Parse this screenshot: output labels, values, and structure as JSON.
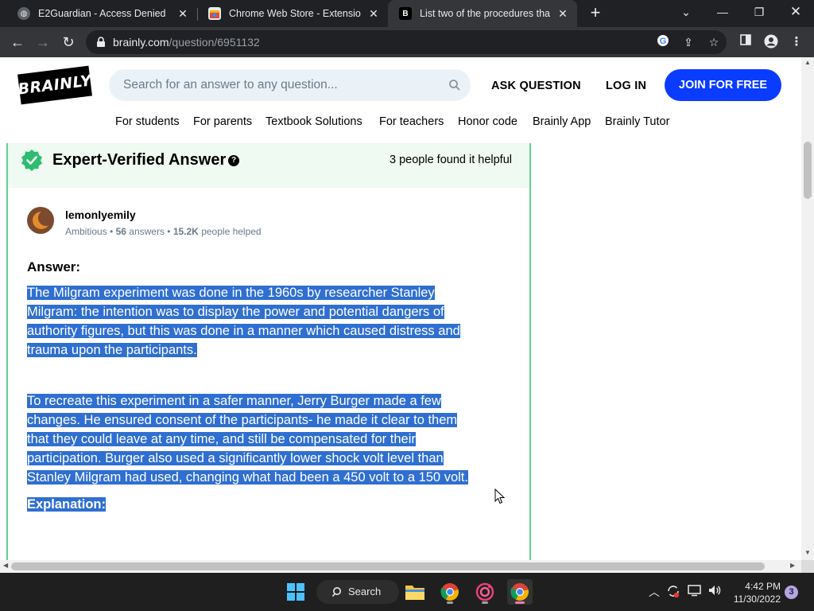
{
  "browser": {
    "tabs": [
      {
        "title": "E2Guardian - Access Denied",
        "active": false
      },
      {
        "title": "Chrome Web Store - Extensions",
        "active": false
      },
      {
        "title": "List two of the procedures that U",
        "active": true
      }
    ],
    "new_tab_symbol": "+",
    "url_domain": "brainly.com",
    "url_path": "/question/6951132",
    "icons": [
      "back-icon",
      "forward-icon",
      "reload-icon",
      "lock-icon",
      "google-icon",
      "share-icon",
      "star-icon",
      "sidepanel-icon",
      "profile-icon",
      "menu-icon"
    ]
  },
  "site": {
    "logo_text": "BRAINLY",
    "search_placeholder": "Search for an answer to any question...",
    "ask_question": "ASK QUESTION",
    "log_in": "LOG IN",
    "join": "JOIN FOR FREE",
    "subnav": [
      "For students",
      "For parents",
      "Textbook Solutions",
      "For teachers",
      "Honor code",
      "Brainly App",
      "Brainly Tutor"
    ]
  },
  "answer": {
    "verified_title": "Expert-Verified Answer",
    "help_symbol": "?",
    "found_helpful": "3 people found it helpful",
    "author": {
      "name": "lemonlyemily",
      "rank": "Ambitious",
      "answers_count": "56",
      "answers_label": "answers",
      "helped_count": "15.2K",
      "helped_label": "people helped"
    },
    "label": "Answer:",
    "paragraph1_lines": [
      "The Milgram experiment was done in the 1960s by researcher Stanley",
      "Milgram: the intention was to display the power and potential dangers of",
      "authority figures, but this was done in a manner which caused distress and",
      "trauma upon the participants."
    ],
    "paragraph2_lines": [
      "To recreate this experiment in a safer manner, Jerry Burger made a few",
      "changes. He ensured consent of the participants- he made it clear to them",
      "that they could leave at any time, and still be compensated for their",
      "participation. Burger also used a significantly lower shock volt level than",
      "Stanley Milgram had used, changing what had been a 450 volt to a 150 volt."
    ],
    "explanation_label": "Explanation:",
    "selection_color": "#2f6fd1",
    "verified_color": "#2dbd6f"
  },
  "taskbar": {
    "search_label": "Search",
    "time": "4:42 PM",
    "date": "11/30/2022",
    "notification_count": "3",
    "apps": [
      "windows-start-icon",
      "file-explorer-icon",
      "chrome-icon",
      "app-icon",
      "chrome-active-icon"
    ]
  }
}
